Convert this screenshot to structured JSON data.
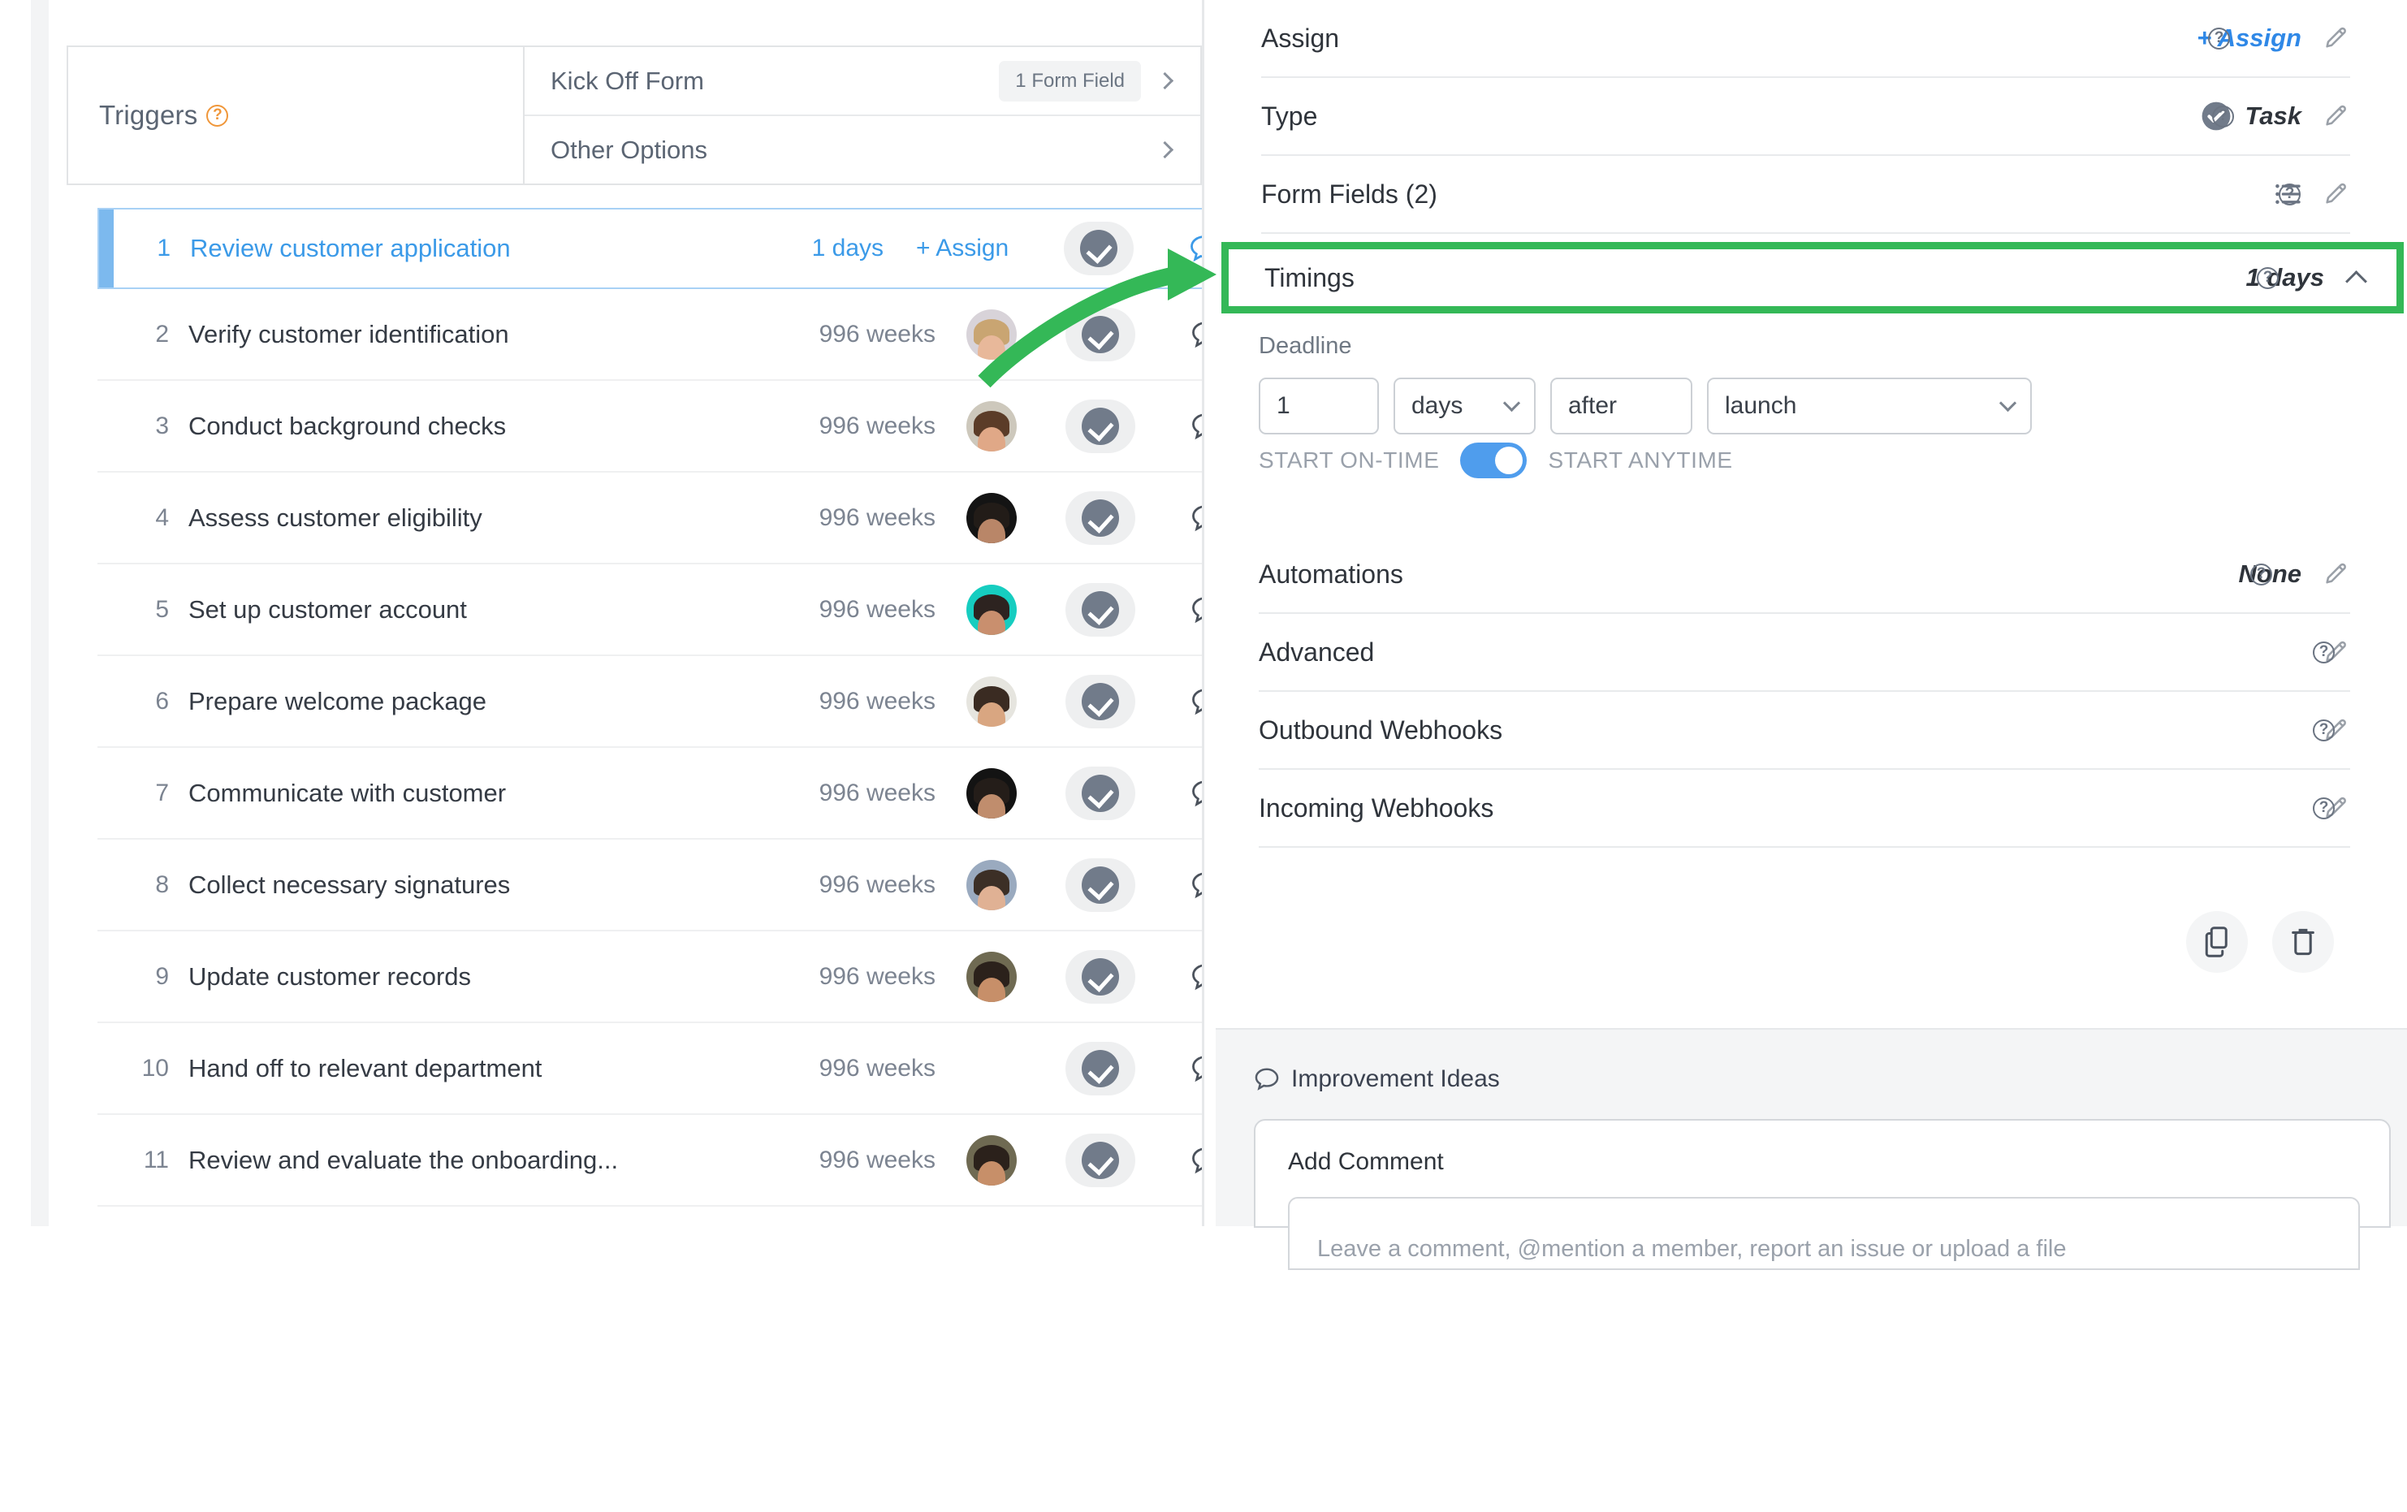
{
  "left_panel": {
    "triggers": {
      "label": "Triggers",
      "help_icon": "help-icon",
      "options": [
        {
          "title": "Kick Off Form",
          "badge": "1 Form Field",
          "chevron": "chevron-right-icon"
        },
        {
          "title": "Other Options",
          "badge": "",
          "chevron": "chevron-right-icon"
        }
      ]
    },
    "tasks": [
      {
        "num": "1",
        "title": "Review customer application",
        "duration": "1 days",
        "assign_label": "+ Assign",
        "has_avatar": false,
        "avatar_bg": "",
        "avatar_hair": "",
        "avatar_skin": "",
        "selected": true
      },
      {
        "num": "2",
        "title": "Verify customer identification",
        "duration": "996 weeks",
        "assign_label": "",
        "has_avatar": true,
        "avatar_bg": "#d8d3d9",
        "avatar_hair": "#c9a572",
        "avatar_skin": "#e8b89a",
        "selected": false
      },
      {
        "num": "3",
        "title": "Conduct background checks",
        "duration": "996 weeks",
        "assign_label": "",
        "has_avatar": true,
        "avatar_bg": "#cdc8bc",
        "avatar_hair": "#5b3c28",
        "avatar_skin": "#e0a887",
        "selected": false
      },
      {
        "num": "4",
        "title": "Assess customer eligibility",
        "duration": "996 weeks",
        "assign_label": "",
        "has_avatar": true,
        "avatar_bg": "#141414",
        "avatar_hair": "#221c18",
        "avatar_skin": "#b98668",
        "selected": false
      },
      {
        "num": "5",
        "title": "Set up customer account",
        "duration": "996 weeks",
        "assign_label": "",
        "has_avatar": true,
        "avatar_bg": "#16cdc0",
        "avatar_hair": "#2d2320",
        "avatar_skin": "#c98f6e",
        "selected": false
      },
      {
        "num": "6",
        "title": "Prepare welcome package",
        "duration": "996 weeks",
        "assign_label": "",
        "has_avatar": true,
        "avatar_bg": "#e6e5df",
        "avatar_hair": "#3a2b22",
        "avatar_skin": "#d9a681",
        "selected": false
      },
      {
        "num": "7",
        "title": "Communicate with customer",
        "duration": "996 weeks",
        "assign_label": "",
        "has_avatar": true,
        "avatar_bg": "#131313",
        "avatar_hair": "#241d19",
        "avatar_skin": "#c08d6d",
        "selected": false
      },
      {
        "num": "8",
        "title": "Collect necessary signatures",
        "duration": "996 weeks",
        "assign_label": "",
        "has_avatar": true,
        "avatar_bg": "#9aaabf",
        "avatar_hair": "#3c2f26",
        "avatar_skin": "#e0b194",
        "selected": false
      },
      {
        "num": "9",
        "title": "Update customer records",
        "duration": "996 weeks",
        "assign_label": "",
        "has_avatar": true,
        "avatar_bg": "#6f6a52",
        "avatar_hair": "#2b211b",
        "avatar_skin": "#c78f69",
        "selected": false
      },
      {
        "num": "10",
        "title": "Hand off to relevant department",
        "duration": "996 weeks",
        "assign_label": "",
        "has_avatar": false,
        "avatar_bg": "",
        "avatar_hair": "",
        "avatar_skin": "",
        "selected": false
      },
      {
        "num": "11",
        "title": "Review and evaluate the onboarding...",
        "duration": "996 weeks",
        "assign_label": "",
        "has_avatar": true,
        "avatar_bg": "#6f6a52",
        "avatar_hair": "#2b211b",
        "avatar_skin": "#c78f69",
        "selected": false
      }
    ]
  },
  "right_panel": {
    "sections_top": [
      {
        "label": "Assign",
        "value": "+ Assign",
        "value_is_link": true,
        "has_check": false,
        "has_list_icon": false
      },
      {
        "label": "Type",
        "value": "Task",
        "value_is_link": false,
        "has_check": true,
        "has_list_icon": false
      },
      {
        "label": "Form Fields (2)",
        "value": "",
        "value_is_link": false,
        "has_check": false,
        "has_list_icon": true
      }
    ],
    "timings": {
      "label": "Timings",
      "value": "1 days",
      "collapse_icon": "chevron-up-icon",
      "highlight_color": "#34b857"
    },
    "deadline": {
      "label": "Deadline",
      "amount": "1",
      "unit": "days",
      "relation": "after",
      "anchor": "launch"
    },
    "start_toggle": {
      "left_label": "START ON-TIME",
      "right_label": "START ANYTIME",
      "on": true,
      "accent": "#4f9ded"
    },
    "sections_bottom": [
      {
        "label": "Automations",
        "value": "None"
      },
      {
        "label": "Advanced",
        "value": ""
      },
      {
        "label": "Outbound Webhooks",
        "value": ""
      },
      {
        "label": "Incoming Webhooks",
        "value": ""
      }
    ],
    "actions": [
      {
        "name": "duplicate-button",
        "icon": "copy-icon"
      },
      {
        "name": "delete-button",
        "icon": "trash-icon"
      }
    ],
    "improvement": {
      "header": "Improvement Ideas",
      "add_comment_label": "Add Comment",
      "comment_placeholder": "Leave a comment, @mention a member, report an issue or upload a file"
    }
  },
  "annotation": {
    "arrow_color": "#34b857"
  }
}
